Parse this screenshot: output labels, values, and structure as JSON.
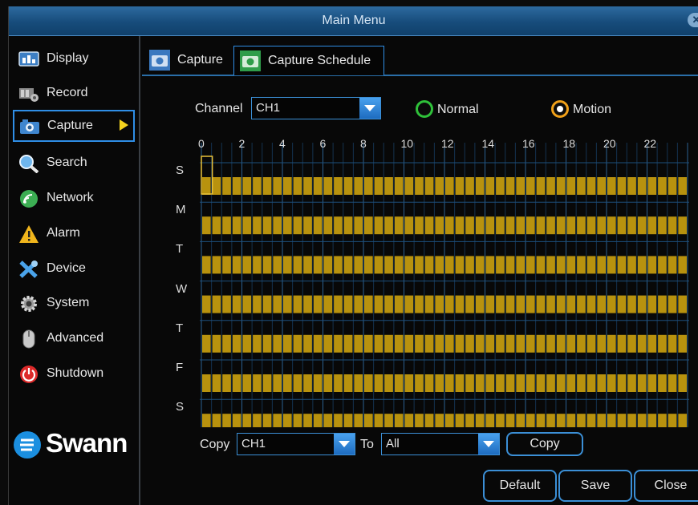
{
  "window": {
    "title": "Main Menu"
  },
  "sidebar": {
    "items": [
      {
        "label": "Display",
        "icon": "display-icon"
      },
      {
        "label": "Record",
        "icon": "record-icon"
      },
      {
        "label": "Capture",
        "icon": "camera-icon",
        "active": true
      },
      {
        "label": "Search",
        "icon": "search-icon"
      },
      {
        "label": "Network",
        "icon": "network-icon"
      },
      {
        "label": "Alarm",
        "icon": "alarm-icon"
      },
      {
        "label": "Device",
        "icon": "device-icon"
      },
      {
        "label": "System",
        "icon": "gear-icon"
      },
      {
        "label": "Advanced",
        "icon": "mouse-icon"
      },
      {
        "label": "Shutdown",
        "icon": "power-icon"
      }
    ],
    "logo_text": "Swann"
  },
  "tabs": [
    {
      "label": "Capture",
      "icon": "camera-icon"
    },
    {
      "label": "Capture Schedule",
      "icon": "schedule-camera-icon",
      "active": true
    }
  ],
  "controls": {
    "channel_label": "Channel",
    "channel_value": "CH1",
    "normal_label": "Normal",
    "motion_label": "Motion",
    "selected_mode": "Motion"
  },
  "schedule": {
    "hour_labels": [
      "0",
      "2",
      "4",
      "6",
      "8",
      "10",
      "12",
      "14",
      "16",
      "18",
      "20",
      "22"
    ],
    "days": [
      "S",
      "M",
      "T",
      "W",
      "T",
      "F",
      "S"
    ],
    "slots_per_day": 48,
    "active_mode": "Motion",
    "filled_all_day": true,
    "colors": {
      "motion_fill": "#b8920e",
      "grid_line": "#1d4f7c",
      "cursor": "#e9c23a"
    }
  },
  "copy_row": {
    "copy_label": "Copy",
    "copy_from_value": "CH1",
    "to_label": "To",
    "copy_to_value": "All",
    "copy_button": "Copy"
  },
  "footer": {
    "default_button": "Default",
    "save_button": "Save",
    "close_button": "Close"
  },
  "colors": {
    "accent": "#2f8ee6",
    "title_bar": "#1d5a8f",
    "arrow": "#f4d31e",
    "normal_radio": "#2fc13a",
    "motion_radio": "#f0a019"
  }
}
